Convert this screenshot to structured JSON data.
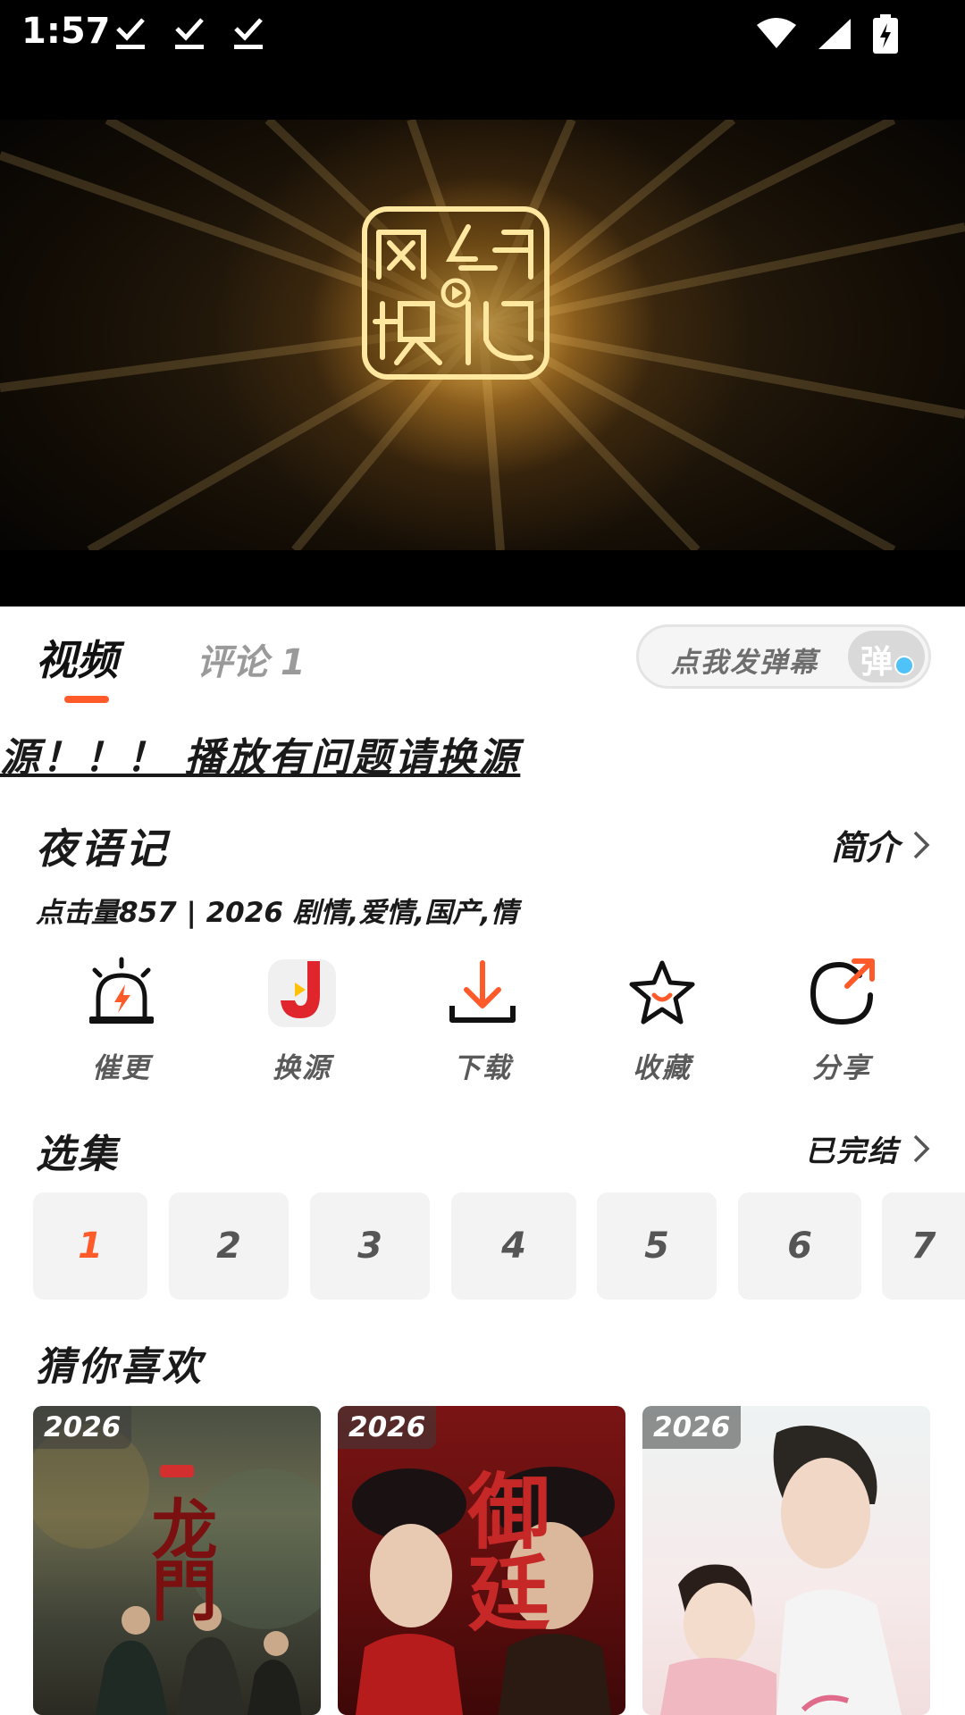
{
  "status_bar": {
    "time": "1:57",
    "download_icons": [
      "download-done-icon",
      "download-done-icon",
      "download-done-icon"
    ],
    "system_icons": [
      "wifi-icon",
      "cell-signal-icon",
      "battery-charging-icon"
    ]
  },
  "player": {
    "logo_lines": [
      "网络",
      "视听"
    ]
  },
  "tabs": {
    "video": "视频",
    "comments": "评论 1",
    "danmaku_placeholder": "点我发弹幕",
    "danmaku_toggle": "弹"
  },
  "notice": "源！！！ 播放有问题请换源",
  "show": {
    "title": "夜语记",
    "intro_label": "简介",
    "meta": "点击量857 | 2026 剧情,爱情,国产,情"
  },
  "actions": [
    {
      "label": "催更",
      "icon": "alarm-urge-icon"
    },
    {
      "label": "换源",
      "icon": "switch-source-icon"
    },
    {
      "label": "下载",
      "icon": "download-icon"
    },
    {
      "label": "收藏",
      "icon": "star-favorite-icon"
    },
    {
      "label": "分享",
      "icon": "share-icon"
    }
  ],
  "episodes": {
    "title": "选集",
    "status": "已完结",
    "items": [
      "1",
      "2",
      "3",
      "4",
      "5",
      "6",
      "7"
    ],
    "active": "1"
  },
  "recommendations": {
    "title": "猜你喜欢",
    "items": [
      {
        "year": "2026",
        "poster_title": "龙門"
      },
      {
        "year": "2026",
        "poster_title": "御廷"
      },
      {
        "year": "2026",
        "poster_title": ""
      }
    ]
  },
  "colors": {
    "accent": "#ff5a2a",
    "status_bar": "#000000",
    "episode_bg": "#f3f3f3",
    "switch_source_red": "#e0252d",
    "share_orange": "#ff5a2a",
    "danmaku_check": "#4fc3f7"
  }
}
